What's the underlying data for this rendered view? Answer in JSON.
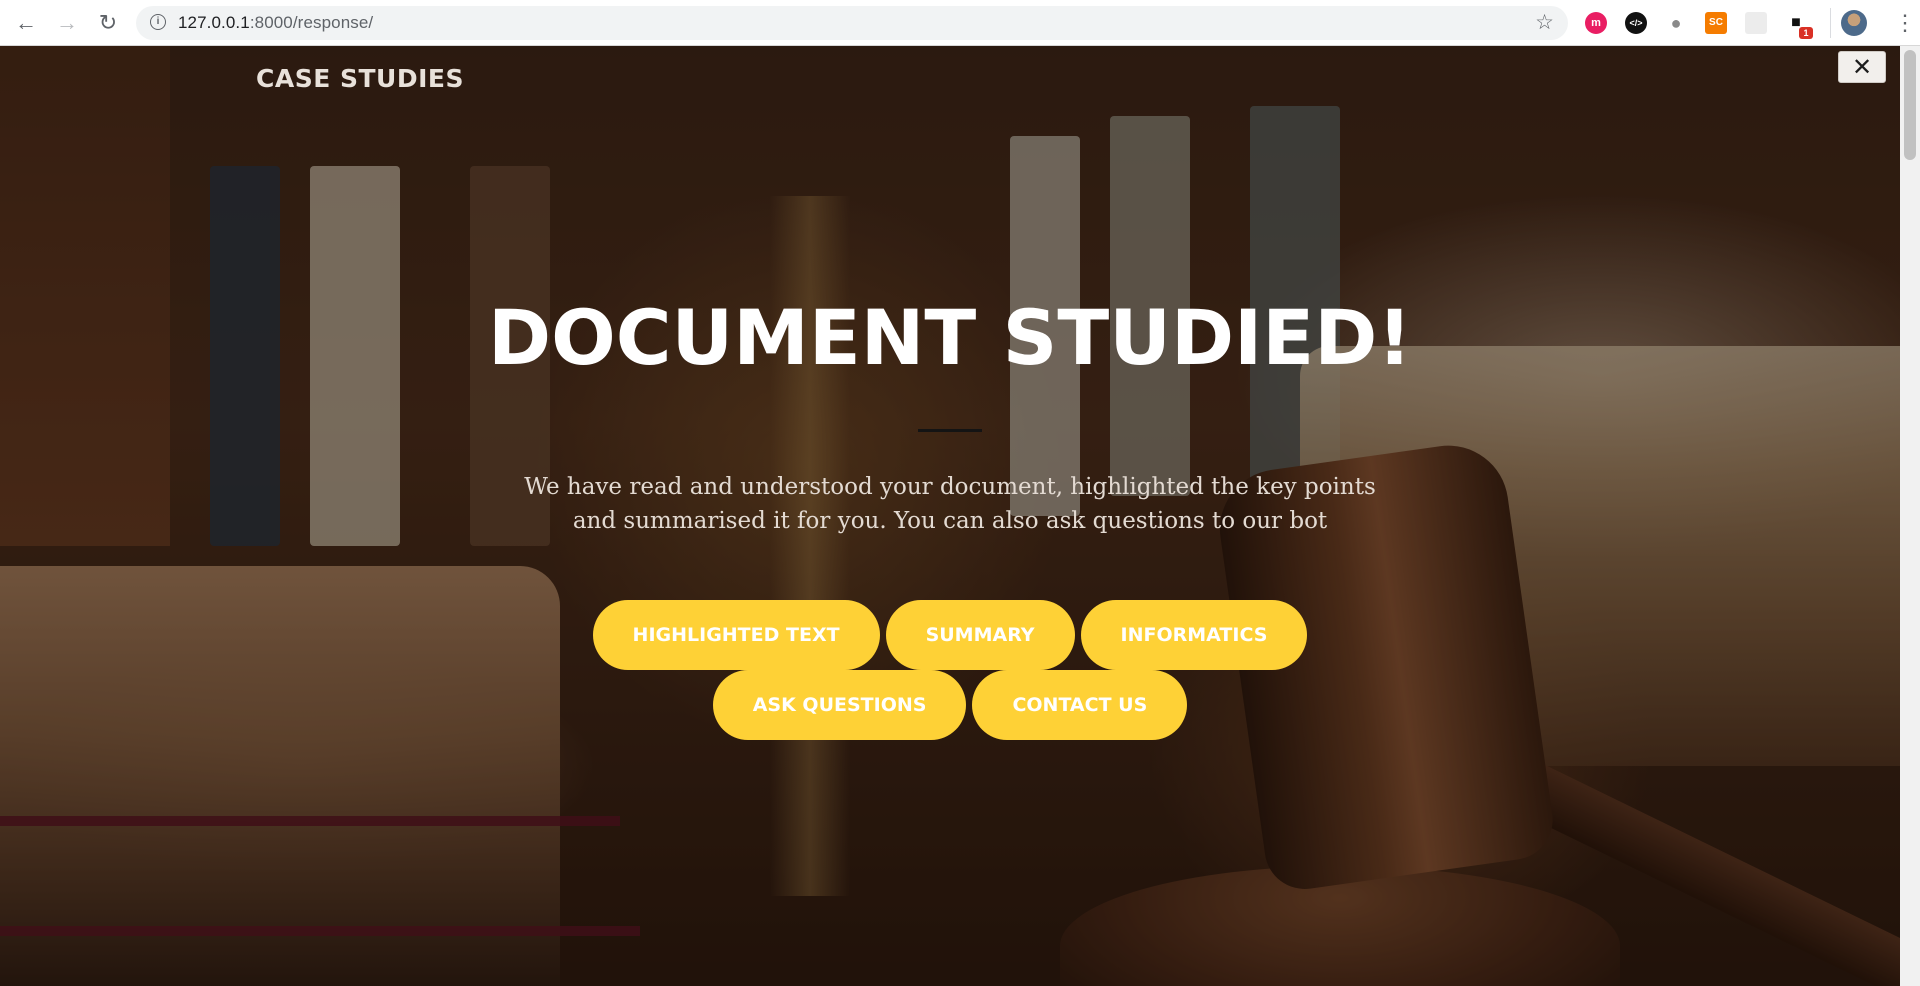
{
  "browser": {
    "url_host": "127.0.0.1",
    "url_path": ":8000/response/",
    "nav": {
      "back": "←",
      "forward": "→",
      "reload": "↻"
    },
    "bookmark_icon": "☆",
    "extensions": [
      {
        "name": "m-extension-icon",
        "glyph": "m",
        "color": "#e91e63"
      },
      {
        "name": "code-extension-icon",
        "glyph": "</>",
        "color": "#111111"
      },
      {
        "name": "circle-extension-icon",
        "glyph": "●",
        "color": "#8a8a8a"
      },
      {
        "name": "sc-extension-icon",
        "glyph": "SC",
        "color": "#f57c00"
      },
      {
        "name": "blank-extension-icon",
        "glyph": "",
        "color": "#e6e6e6"
      },
      {
        "name": "badge-extension-icon",
        "glyph": "■",
        "color": "#111111",
        "badge": "1"
      }
    ],
    "menu_glyph": "⋮"
  },
  "site": {
    "brand": "CASE STUDIES",
    "close_glyph": "✕"
  },
  "hero": {
    "title": "DOCUMENT STUDIED!",
    "subtitle": "We have read and understood your document, highlighted the key points and summarised it for you. You can also ask questions to our bot",
    "accent": "#fed136"
  },
  "buttons": {
    "row1": [
      "HIGHLIGHTED TEXT",
      "SUMMARY",
      "INFORMATICS"
    ],
    "row2": [
      "ASK QUESTIONS",
      "CONTACT US"
    ]
  }
}
